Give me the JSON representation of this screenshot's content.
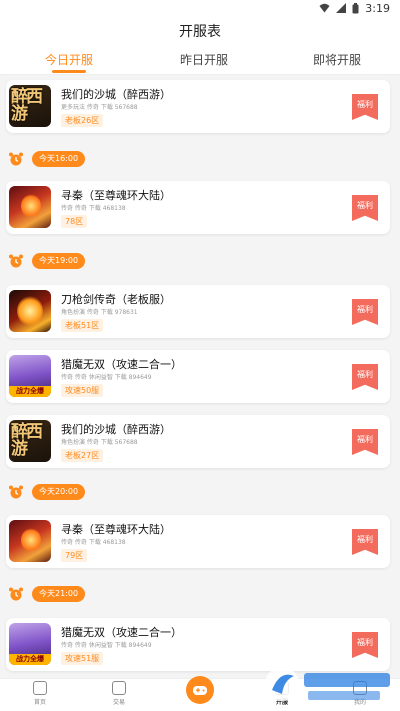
{
  "status_bar": {
    "time": "3:19"
  },
  "header": {
    "title": "开服表"
  },
  "tabs": [
    {
      "label": "今日开服",
      "active": true
    },
    {
      "label": "昨日开服",
      "active": false
    },
    {
      "label": "即将开服",
      "active": false
    }
  ],
  "cards": [
    {
      "title": "我们的沙城（醉西游）",
      "meta": "更多玩法 传奇 下载 567688",
      "server": "老板26区",
      "welfare": "福利",
      "thumb": "game-thumb-xiyou",
      "thumb_text": "醉西游"
    },
    {
      "title": "寻秦（至尊魂环大陆）",
      "meta": "传奇 传奇 下载 468138",
      "server": "78区",
      "welfare": "福利",
      "thumb": "game-thumb-xunqin"
    },
    {
      "title": "刀枪剑传奇（老板服）",
      "meta": "角色扮演 传奇 下载 978631",
      "server": "老板51区",
      "welfare": "福利",
      "thumb": "game-thumb-daoqiang"
    },
    {
      "title": "猎魔无双（攻速二合一）",
      "meta": "传奇 传奇 休闲益智 下载 894649",
      "server": "攻速50服",
      "welfare": "福利",
      "thumb": "game-thumb-liemo",
      "thumb_text": "战力全爆"
    },
    {
      "title": "我们的沙城（醉西游）",
      "meta": "角色扮演 传奇 下载 567688",
      "server": "老板27区",
      "welfare": "福利",
      "thumb": "game-thumb-xiyou",
      "thumb_text": "醉西游"
    },
    {
      "title": "寻秦（至尊魂环大陆）",
      "meta": "传奇 传奇 下载 468138",
      "server": "79区",
      "welfare": "福利",
      "thumb": "game-thumb-xunqin"
    },
    {
      "title": "猎魔无双（攻速二合一）",
      "meta": "传奇 传奇 休闲益智 下载 894649",
      "server": "攻速51服",
      "welfare": "福利",
      "thumb": "game-thumb-liemo",
      "thumb_text": "战力全爆"
    }
  ],
  "time_groups": [
    {
      "label": "今天16:00"
    },
    {
      "label": "今天19:00"
    },
    {
      "label": "今天20:00"
    },
    {
      "label": "今天21:00"
    }
  ],
  "bottom_nav": [
    {
      "label": "首页",
      "icon": "home-icon"
    },
    {
      "label": "交易",
      "icon": "trade-icon"
    },
    {
      "label": "",
      "icon": "gamepad-icon"
    },
    {
      "label": "开服",
      "icon": "server-list-icon",
      "active": true
    },
    {
      "label": "我的",
      "icon": "profile-icon"
    }
  ],
  "colors": {
    "accent": "#ff8a1c",
    "welfare": "#f26b5d",
    "background": "#f4f4f4"
  }
}
